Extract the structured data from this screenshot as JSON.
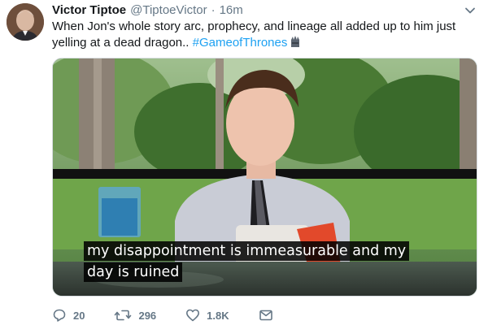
{
  "tweet": {
    "author_name": "Victor Tiptoe",
    "author_handle": "@TiptoeVictor",
    "separator": "·",
    "time_ago": "16m",
    "text": "When Jon's whole story arc, prophecy, and lineage all added up to him just yelling at a dead dragon.. ",
    "hashtag": "#GameofThrones"
  },
  "media": {
    "subtitle_line1": "my disappointment is immeasurable and my",
    "subtitle_line2": "day is ruined"
  },
  "actions": {
    "reply_count": "20",
    "retweet_count": "296",
    "like_count": "1.8K"
  },
  "icons": {
    "menu": "chevron-down-icon",
    "hashtag_emoji": "iron-throne-icon",
    "reply": "reply-icon",
    "retweet": "retweet-icon",
    "like": "heart-icon",
    "dm": "envelope-icon"
  },
  "colors": {
    "link": "#1da1f2",
    "muted": "#657786",
    "text": "#14171a"
  }
}
